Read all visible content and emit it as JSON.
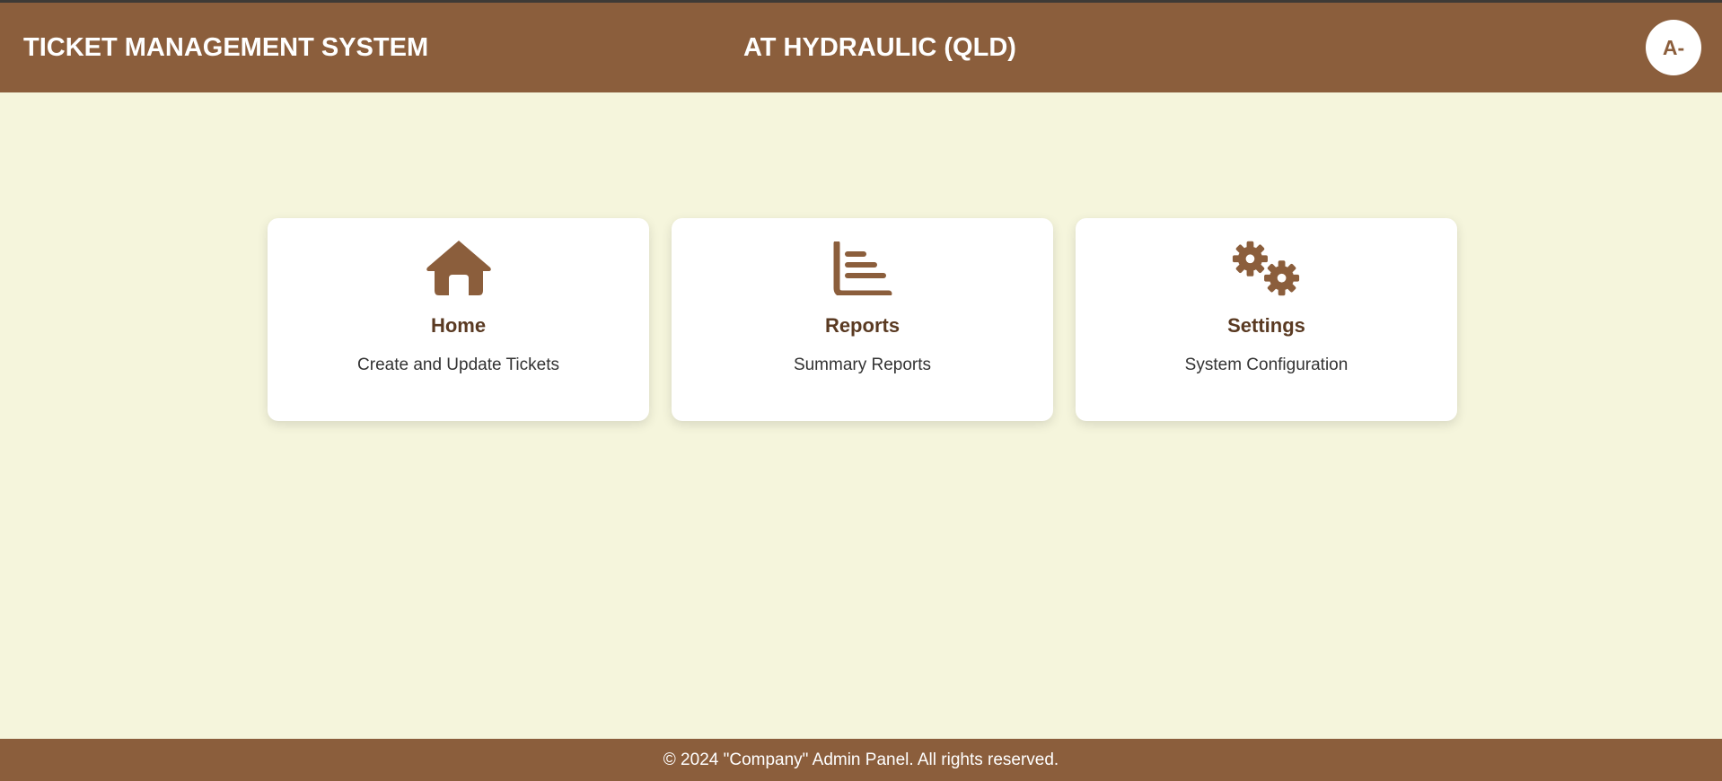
{
  "header": {
    "app_title": "TICKET MANAGEMENT SYSTEM",
    "company": "AT HYDRAULIC (QLD)",
    "avatar_initials": "A-"
  },
  "cards": [
    {
      "icon": "home-icon",
      "title": "Home",
      "description": "Create and Update Tickets"
    },
    {
      "icon": "bar-chart-icon",
      "title": "Reports",
      "description": "Summary Reports"
    },
    {
      "icon": "gears-icon",
      "title": "Settings",
      "description": "System Configuration"
    }
  ],
  "footer": {
    "text": "© 2024 \"Company\" Admin Panel. All rights reserved."
  },
  "colors": {
    "brand": "#8b5e3c",
    "background": "#f5f5dc",
    "card_title": "#5a3a22"
  }
}
